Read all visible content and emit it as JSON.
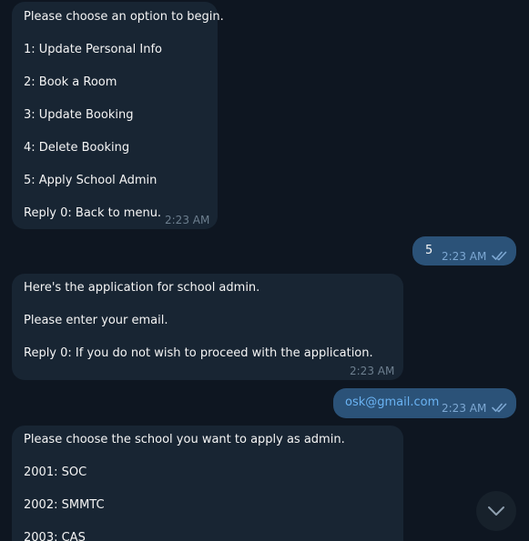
{
  "messages": [
    {
      "lines": [
        "Please choose an option to begin.",
        "1: Update Personal Info",
        "2: Book a Room",
        "3: Update Booking",
        "4: Delete Booking",
        "5: Apply School Admin",
        "Reply 0: Back to menu."
      ],
      "time": "2:23 AM"
    },
    {
      "text": "5",
      "time": "2:23 AM"
    },
    {
      "lines": [
        "Here's the application for school admin.",
        "Please enter your email.",
        "Reply 0: If you do not wish to proceed with the application."
      ],
      "time": "2:23 AM"
    },
    {
      "text": "osk@gmail.com",
      "time": "2:23 AM"
    },
    {
      "lines": [
        "Please choose the school you want to apply as admin.",
        "2001: SOC",
        "2002: SMMTC",
        "2003: CAS"
      ]
    }
  ],
  "colors": {
    "background": "#0e1621",
    "incoming_bubble": "#182533",
    "outgoing_bubble": "#2b5278",
    "link": "#6ab3f3",
    "read_checks": "#7da8d3"
  },
  "icons": {
    "read_status": "double-check-icon",
    "scroll_down": "chevron-down-icon"
  }
}
